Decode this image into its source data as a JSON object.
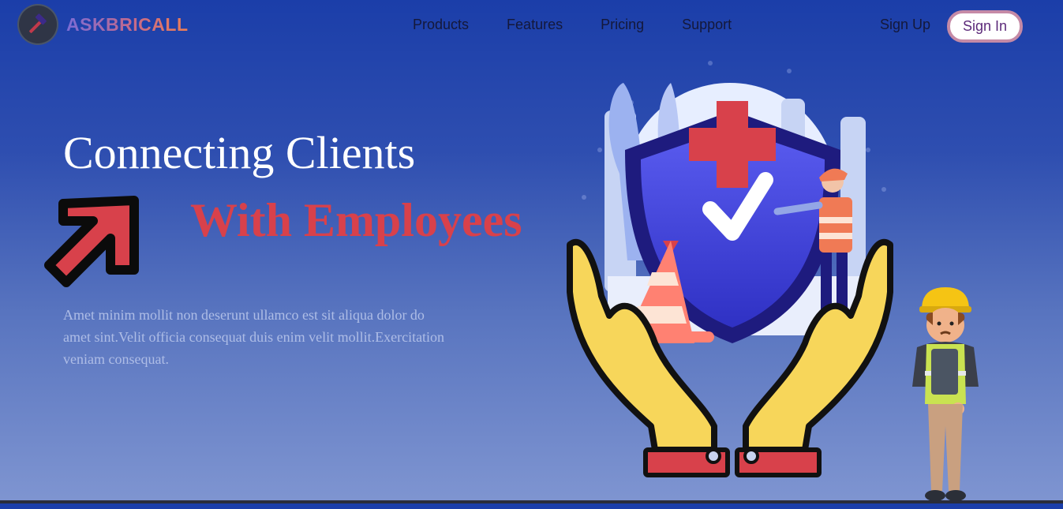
{
  "brand": {
    "name": "ASKBRICALL",
    "logo_icon": "hammer-icon"
  },
  "nav": {
    "items": [
      {
        "label": "Products"
      },
      {
        "label": "Features"
      },
      {
        "label": "Pricing"
      },
      {
        "label": "Support"
      }
    ],
    "sign_up": "Sign Up",
    "sign_in": "Sign In"
  },
  "hero": {
    "title_line1": "Connecting Clients",
    "title_line2": "With Employees",
    "arrow_icon": "arrow-up-right-icon",
    "description": "Amet minim mollit non deserunt ullamco est sit aliqua dolor do amet sint.Velit officia consequat duis enim velit mollit.Exercitation veniam consequat."
  },
  "colors": {
    "accent_red": "#d8414b",
    "background_top": "#1b3ea9",
    "background_bottom": "#7f95d1",
    "shield_blue": "#3d3fd6",
    "hands_yellow": "#f7d65a"
  }
}
